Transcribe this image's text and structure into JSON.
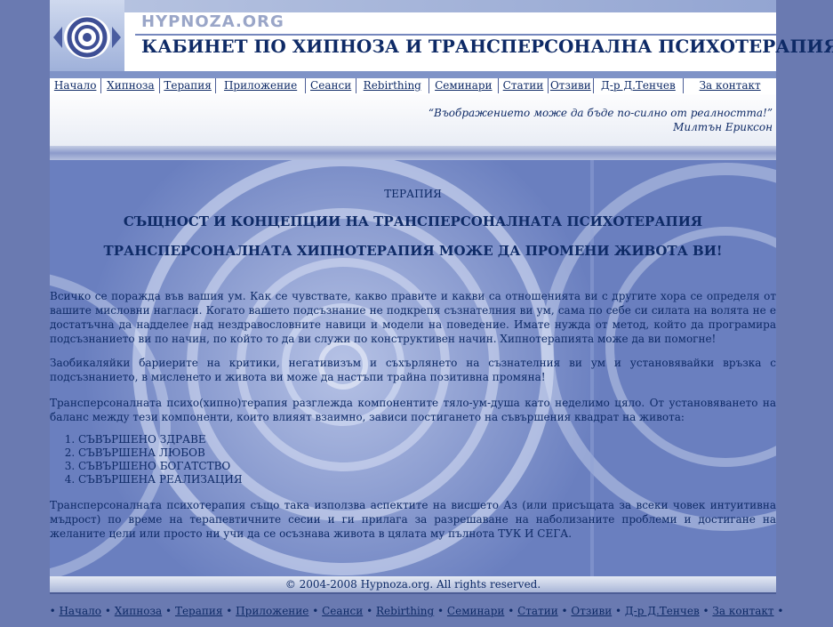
{
  "header": {
    "logo_text": "HYPNOZA.ORG",
    "title": "КАБИНЕТ ПО ХИПНОЗА И ТРАНСПЕРСОНАЛНА ПСИХОТЕРАПИЯ"
  },
  "nav": [
    "Начало",
    "Хипноза",
    "Терапия",
    "Приложение",
    "Сеанси",
    "Rebirthing",
    "Семинари",
    "Статии",
    "Отзиви",
    "Д-р Д.Тенчев",
    "За контакт"
  ],
  "quote": {
    "text": "“Въображението може да бъде по-силно от реалността!”",
    "author": "Милтън Ериксон"
  },
  "content": {
    "section_label": "ТЕРАПИЯ",
    "heading1": "СЪЩНОСТ И КОНЦЕПЦИИ НА ТРАНСПЕРСОНАЛНАТА ПСИХОТЕРАПИЯ",
    "heading2": "ТРАНСПЕРСОНАЛНАТА ХИПНОТЕРАПИЯ МОЖЕ ДА ПРОМЕНИ ЖИВОТА ВИ!",
    "p1": "Всичко се поражда във вашия ум. Как се чувствате, какво правите и какви са отношенията ви с другите хора се определя от вашите мисловни нагласи. Когато вашето подсъзнание не подкрепя съзнателния ви ум, сама по себе си силата на волята не е достатъчна да надделее над нездравословните навици и модели на поведение. Имате нужда от метод, който да програмира подсъзнанието ви по начин, по който то да ви служи по конструктивен начин. Хипнотерапията може да ви помогне!",
    "p2": "Заобикаляйки бариерите на критики, негативизъм и съхърлянето на съзнателния ви ум и установявайки връзка с подсъзнанието, в мисленето и живота ви може да настъпи трайна позитивна промяна!",
    "p3": "Трансперсоналната психо(хипно)терапия разглежда компонентите тяло-ум-душа като неделимо цяло. От установяването на баланс между тези компоненти, които влияят взаимно, зависи постигането на съвършения квадрат на живота:",
    "list": [
      "СЪВЪРШЕНО ЗДРАВЕ",
      "СЪВЪРШЕНА ЛЮБОВ",
      "СЪВЪРШЕНО БОГАТСТВО",
      "СЪВЪРШЕНА РЕАЛИЗАЦИЯ"
    ],
    "p4": "Трансперсоналната психотерапия също така използва аспектите на висшето Аз (или присъщата за всеки човек интуитивна мъдрост) по време на терапевтичните сесии и ги прилага за разрешаване на наболизаните проблеми и достигане на желаните цели или просто ни учи да се осъзнава живота в цялата му пълнота ТУК И СЕГА."
  },
  "footer": {
    "copyright": "© 2004-2008 Hypnoza.org. All rights reserved.",
    "links": [
      "Начало",
      "Хипноза",
      "Терапия",
      "Приложение",
      "Сеанси",
      "Rebirthing",
      "Семинари",
      "Статии",
      "Отзиви",
      "Д-р Д.Тенчев",
      "За контакт"
    ],
    "separator": "•"
  }
}
